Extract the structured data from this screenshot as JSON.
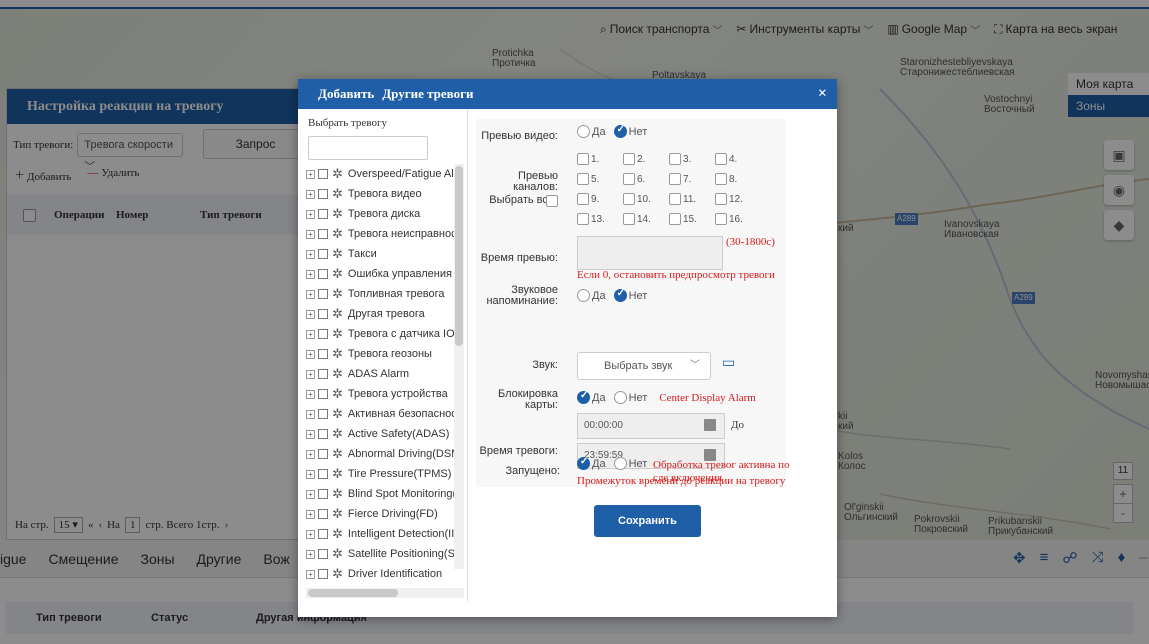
{
  "map": {
    "labels": [
      {
        "id": "protichka",
        "text": "Protichka\nПротичка"
      },
      {
        "id": "poltavskaya",
        "text": "Poltavskaya"
      },
      {
        "id": "staroniz",
        "text": "Staronizhestebliyevskaya\nСтаронижестеблиевская"
      },
      {
        "id": "vostochnyi",
        "text": "Vostochnyi\nВосточный"
      },
      {
        "id": "ivanovskaya",
        "text": "Ivanovskaya\nИвановская"
      },
      {
        "id": "novomysh",
        "text": "Novomyshasto\nНовомышаст"
      },
      {
        "id": "kolos",
        "text": "Kolos\nКолос"
      },
      {
        "id": "olginskii",
        "text": "Ol'ginskii\nОльгинский"
      },
      {
        "id": "pokrovskii",
        "text": "Pokrovskii\nПокровский"
      },
      {
        "id": "prikubanskii",
        "text": "Prikubanskii\nПрикубанский"
      },
      {
        "id": "kii1",
        "text": "кий"
      },
      {
        "id": "kii2",
        "text": "kii\nкий"
      }
    ],
    "road_a289_1": "A289",
    "road_a289_2": "A289",
    "toolbar": {
      "search_vehicle": "Поиск транспорта",
      "map_tools": "Инструменты карты",
      "google_map": "Google Map",
      "fullscreen": "Карта на весь экран"
    },
    "menu": {
      "my_map": "Моя карта",
      "zones": "Зоны"
    },
    "zoom_level": "11",
    "zoom_in": "+",
    "zoom_out": "-"
  },
  "left_panel": {
    "title": "Настройка реакции на тревогу",
    "alarm_type_label": "Тип тревоги:",
    "alarm_type_value": "Тревога скорости",
    "query_button": "Запрос",
    "add": "Добавить",
    "delete": "Удалить",
    "columns": [
      "Операции",
      "Номер",
      "Тип тревоги"
    ],
    "pager": {
      "per_page_label": "На стр.",
      "per_page_value": "15",
      "page_label": "На",
      "page_value": "1",
      "total": "стр. Всего 1стр."
    }
  },
  "bottom": {
    "tabs": [
      "igue",
      "Смещение",
      "Зоны",
      "Другие",
      "Вож"
    ],
    "columns": [
      "Тип тревоги",
      "Статус",
      "Другая информация"
    ]
  },
  "dialog": {
    "title_add": "Добавить",
    "title_other": "Другие тревоги",
    "close": "×",
    "select_alarm_label": "Выбрать тревогу",
    "search_placeholder": "",
    "tree_items": [
      "Overspeed/Fatigue Ala",
      "Тревога видео",
      "Тревога диска",
      "Тревога неисправнос",
      "Такси",
      "Ошибка управления",
      "Топливная тревога",
      "Другая тревога",
      "Тревога с датчика IO",
      "Тревога геозоны",
      "ADAS Alarm",
      "Тревога устройства",
      "Активная безопаснос",
      "Active Safety(ADAS)",
      "Abnormal Driving(DSM",
      "Tire Pressure(TPMS)",
      "Blind Spot Monitoring(",
      "Fierce Driving(FD)",
      "Intelligent Detection(II",
      "Satellite Positioning(SF",
      "Driver Identification"
    ],
    "form": {
      "preview_video_label": "Превью видео:",
      "yes": "Да",
      "no": "Нет",
      "preview_channels_label": "Превью каналов:",
      "select_all_label": "Выбрать все",
      "channels": [
        "1.",
        "2.",
        "3.",
        "4.",
        "5.",
        "6.",
        "7.",
        "8.",
        "9.",
        "10.",
        "11.",
        "12.",
        "13.",
        "14.",
        "15.",
        "16."
      ],
      "preview_time_label": "Время превью:",
      "preview_time_range": "(30-1800c)",
      "preview_time_hint": "Если 0, остановить предпросмотр тревоги",
      "sound_reminder_label": "Звуковое напоминание:",
      "sound_label": "Звук:",
      "sound_value": "Выбрать звук",
      "map_lock_label": "Блокировка карты:",
      "center_display": "Center Display Alarm",
      "alarm_time_label": "Время тревоги:",
      "time_start": "00:00:00",
      "time_end": "23:59:59",
      "to": "До",
      "time_hint": "Промежуток времени до реакции на тревогу",
      "enabled_label": "Запущено:",
      "enabled_hint": "Обработка тревог активна по сле включения"
    },
    "save_button": "Сохранить"
  },
  "colors": {
    "accent": "#1e5fa8",
    "warning": "#d71919"
  }
}
